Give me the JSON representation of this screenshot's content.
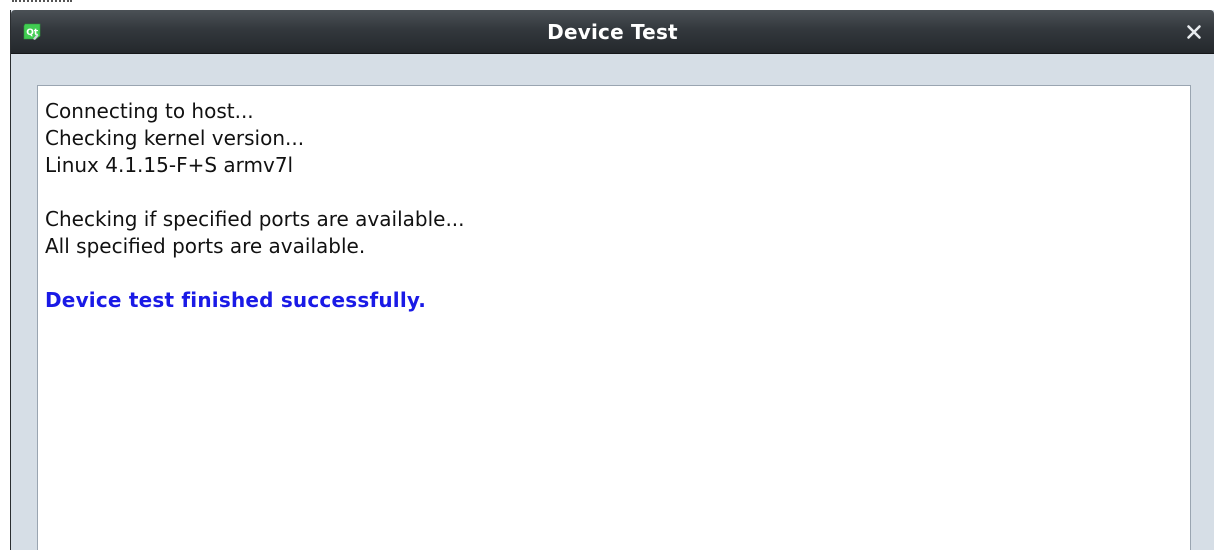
{
  "window": {
    "title": "Device Test",
    "close_label": "×"
  },
  "icons": {
    "app": "qt-creator-icon",
    "close": "close-icon"
  },
  "log": {
    "lines_group1": [
      "Connecting to host...",
      "Checking kernel version...",
      "Linux 4.1.15-F+S armv7l"
    ],
    "lines_group2": [
      "Checking if specified ports are available...",
      "All specified ports are available."
    ],
    "success_message": "Device test finished successfully."
  },
  "colors": {
    "titlebar_dark": "#24282c",
    "titlebar_light": "#4b5156",
    "dialog_bg": "#d6dee6",
    "success_text": "#1a1ae6",
    "icon_green": "#41cd52"
  }
}
